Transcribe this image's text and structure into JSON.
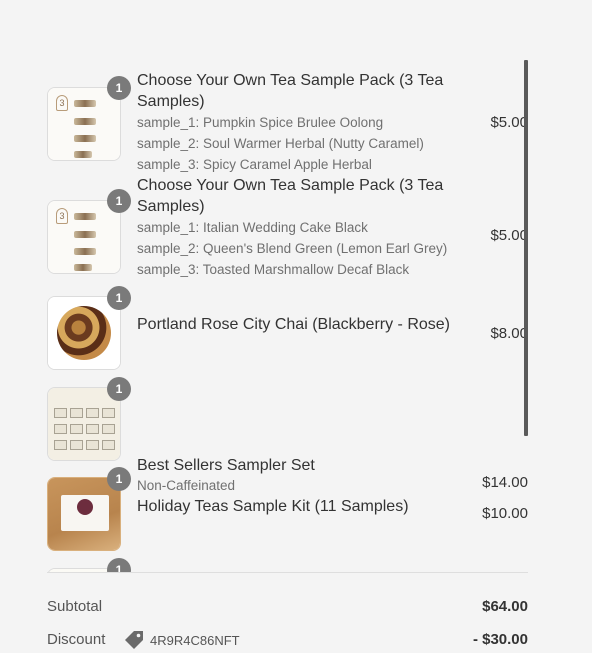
{
  "items": [
    {
      "qty": "1",
      "name": "Choose Your Own Tea Sample Pack (3 Tea Samples)",
      "options": [
        "sample_1: Pumpkin Spice Brulee Oolong",
        "sample_2: Soul Warmer Herbal (Nutty Caramel)",
        "sample_3: Spicy Caramel Apple Herbal"
      ],
      "price": "$5.00",
      "image": "sample-pack-image"
    },
    {
      "qty": "1",
      "name": "Choose Your Own Tea Sample Pack (3 Tea Samples)",
      "options": [
        "sample_1: Italian Wedding Cake Black",
        "sample_2: Queen's Blend Green (Lemon Earl Grey)",
        "sample_3: Toasted Marshmallow Decaf Black"
      ],
      "price": "$5.00",
      "image": "sample-pack-image"
    },
    {
      "qty": "1",
      "name": "Portland Rose City Chai (Blackberry - Rose)",
      "options": [],
      "price": "$8.00",
      "image": "loose-leaf-chai-image"
    },
    {
      "qty": "1",
      "name": "Best Sellers Sampler Set",
      "options": [
        "Non-Caffeinated"
      ],
      "price": "$14.00",
      "image": "sampler-set-image"
    },
    {
      "qty": "1",
      "name": "Holiday Teas Sample Kit (11 Samples)",
      "options": [],
      "price": "$10.00",
      "image": "holiday-kit-image"
    },
    {
      "qty": "1",
      "image": "partial-item-image"
    }
  ],
  "summary": {
    "subtotal_label": "Subtotal",
    "subtotal_value": "$64.00",
    "discount_label": "Discount",
    "discount_code": "4R9R4C86NFT",
    "discount_value": "- $30.00",
    "tag_icon": "tag-icon"
  },
  "colors": {
    "background": "#f4f4f4",
    "badge": "#7a7a7a",
    "scrollbar": "#5a5a5a"
  }
}
